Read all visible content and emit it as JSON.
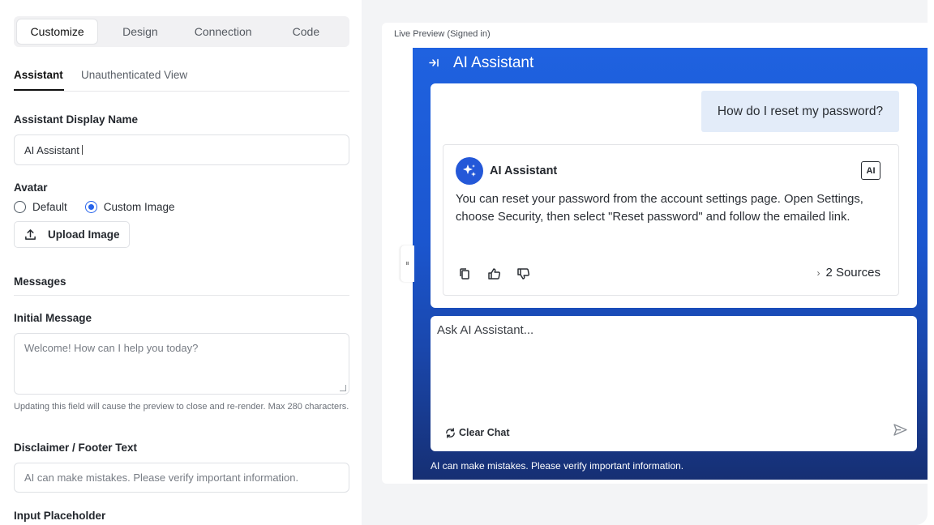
{
  "tabs": [
    "Customize",
    "Design",
    "Connection",
    "Code"
  ],
  "active_tab": "Customize",
  "subtabs": [
    "Assistant",
    "Unauthenticated View"
  ],
  "form": {
    "display_name_label": "Assistant Display Name",
    "display_name_value": "AI Assistant",
    "avatar_label": "Avatar",
    "avatar_options": [
      "Default",
      "Custom Image"
    ],
    "avatar_selected": "Custom Image",
    "upload_button": "Upload Image",
    "messages_heading": "Messages",
    "initial_message_label": "Initial Message",
    "initial_message_placeholder": "Welcome! How can I help you today?",
    "initial_message_help": "Updating this field will cause the preview to close and re-render. Max 280 characters.",
    "disclaimer_label": "Disclaimer / Footer Text",
    "disclaimer_value": "AI can make mistakes. Please verify important information.",
    "input_placeholder_label": "Input Placeholder"
  },
  "preview": {
    "title": "Live Preview (Signed in)",
    "handle_glyph": "⏸",
    "widget_title": "AI Assistant",
    "user_message": "How do I reset my password?",
    "assistant_name": "AI Assistant",
    "ai_badge": "AI",
    "assistant_message": "You can reset your password from the account settings page. Open Settings, choose Security, then select \"Reset password\" and follow the emailed link.",
    "sources_label": "2 Sources",
    "composer_placeholder": "Ask AI Assistant...",
    "clear_chat": "Clear Chat",
    "disclaimer": "AI can make mistakes. Please verify important information."
  },
  "colors": {
    "accent": "#2563eb",
    "widget_bg_top": "#1f62e0",
    "widget_bg_bottom": "#162f73",
    "user_bubble": "#e3ecf9"
  },
  "icons": [
    "upload-icon",
    "collapse-panel-icon",
    "sparkle-icon",
    "copy-icon",
    "thumbs-up-icon",
    "thumbs-down-icon",
    "chevron-right-icon",
    "refresh-icon",
    "send-icon",
    "drag-handle-icon"
  ]
}
